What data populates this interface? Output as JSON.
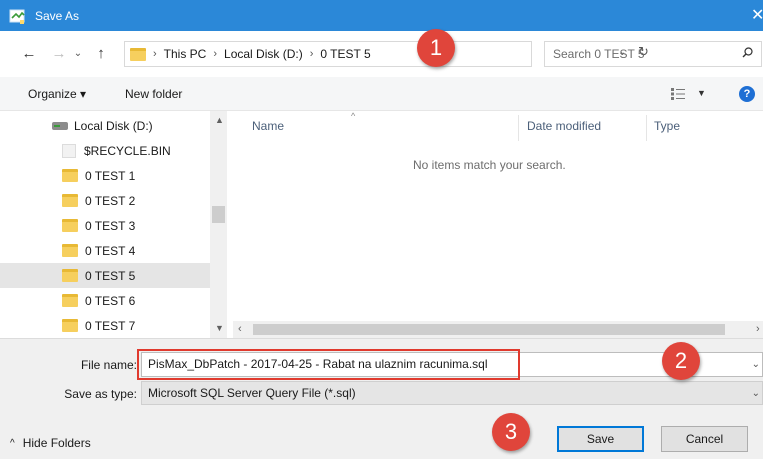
{
  "window": {
    "title": "Save As"
  },
  "address": {
    "crumbs": [
      "This PC",
      "Local Disk (D:)",
      "0 TEST 5"
    ]
  },
  "search": {
    "placeholder": "Search 0 TEST 5"
  },
  "toolbar": {
    "organize": "Organize ▾",
    "new_folder": "New folder",
    "help": "?"
  },
  "nav": {
    "items": [
      {
        "label": "Local Disk (D:)",
        "kind": "drive"
      },
      {
        "label": "$RECYCLE.BIN",
        "kind": "recycle"
      },
      {
        "label": "0 TEST 1",
        "kind": "folder"
      },
      {
        "label": "0 TEST 2",
        "kind": "folder"
      },
      {
        "label": "0 TEST 3",
        "kind": "folder"
      },
      {
        "label": "0 TEST 4",
        "kind": "folder"
      },
      {
        "label": "0 TEST 5",
        "kind": "folder",
        "selected": true
      },
      {
        "label": "0 TEST 6",
        "kind": "folder"
      },
      {
        "label": "0 TEST 7",
        "kind": "folder"
      }
    ]
  },
  "columns": {
    "name": "Name",
    "date": "Date modified",
    "type": "Type"
  },
  "main": {
    "empty_message": "No items match your search."
  },
  "fields": {
    "file_name_label": "File name:",
    "file_name_value": "PisMax_DbPatch - 2017-04-25 - Rabat na ulaznim racunima.sql",
    "save_type_label": "Save as type:",
    "save_type_value": "Microsoft SQL Server Query File (*.sql)"
  },
  "footer": {
    "hide_folders": "Hide Folders",
    "save": "Save",
    "cancel": "Cancel"
  },
  "callouts": [
    "1",
    "2",
    "3"
  ],
  "colors": {
    "titlebar": "#2b88d8",
    "callout": "#e0453b",
    "highlight": "#e03a2e",
    "selection": "#e5e5e5"
  }
}
